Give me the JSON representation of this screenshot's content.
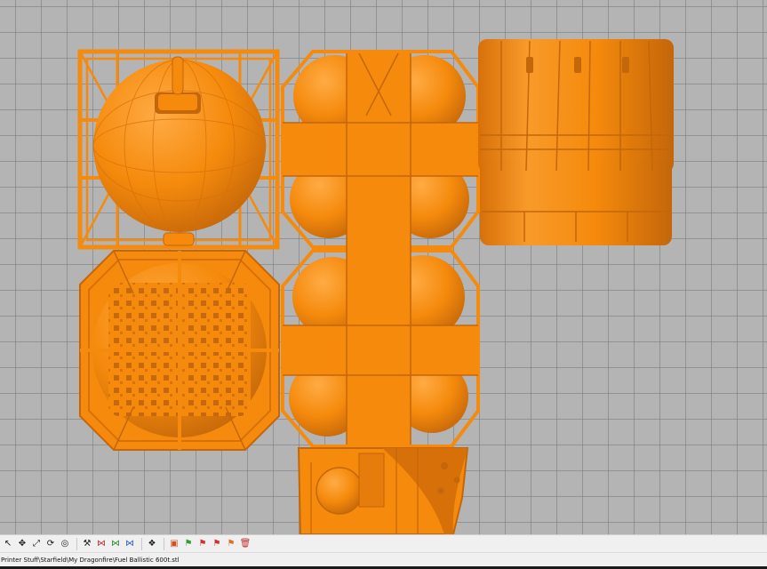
{
  "window": {
    "status_path": "Printer Stuff\\Starfield\\My Dragonfire\\Fuel Ballistic 600t.stl"
  },
  "colors": {
    "viewport_bg": "#b4b4b4",
    "grid_line": "#8c8c8c",
    "model_orange": "#f58a0c",
    "model_shadow": "#c4660a",
    "model_highlight": "#ffa63a",
    "toolbar_bg": "#f0f0f0"
  },
  "toolbar": {
    "buttons": [
      {
        "id": "select",
        "icon": "select-arrow-icon",
        "glyph": "↖",
        "color": "#1a1a1a"
      },
      {
        "id": "move",
        "icon": "move-icon",
        "glyph": "✥",
        "color": "#1a1a1a"
      },
      {
        "id": "scale",
        "icon": "scale-icon",
        "glyph": "⤢",
        "color": "#1a1a1a"
      },
      {
        "id": "rotate",
        "icon": "rotate-icon",
        "glyph": "⟳",
        "color": "#1a1a1a"
      },
      {
        "id": "mirror",
        "icon": "mirror-icon",
        "glyph": "◎",
        "color": "#1a1a1a"
      },
      {
        "id": "cut",
        "icon": "cut-icon",
        "glyph": "⚒",
        "color": "#1a1a1a"
      },
      {
        "id": "mirror-x",
        "icon": "mirror-x-icon",
        "glyph": "⋈",
        "color": "#c03030"
      },
      {
        "id": "mirror-y",
        "icon": "mirror-y-icon",
        "glyph": "⋈",
        "color": "#2f8f2f"
      },
      {
        "id": "mirror-z",
        "icon": "mirror-z-icon",
        "glyph": "⋈",
        "color": "#2f5fcf"
      },
      {
        "id": "group",
        "icon": "group-icon",
        "glyph": "❖",
        "color": "#1a1a1a"
      },
      {
        "id": "support",
        "icon": "support-icon",
        "glyph": "▣",
        "color": "#d0501a"
      },
      {
        "id": "flag-green",
        "icon": "flag-green-icon",
        "glyph": "⚑",
        "color": "#2f9f2f"
      },
      {
        "id": "flag-red",
        "icon": "flag-red-icon",
        "glyph": "⚑",
        "color": "#d03030"
      },
      {
        "id": "flag-red-2",
        "icon": "flag-red-icon",
        "glyph": "⚑",
        "color": "#d03030"
      },
      {
        "id": "flag-orange",
        "icon": "flag-orange-icon",
        "glyph": "⚑",
        "color": "#e07020"
      },
      {
        "id": "delete",
        "icon": "trash-icon",
        "glyph": "🗑",
        "color": "#c03030"
      }
    ]
  }
}
